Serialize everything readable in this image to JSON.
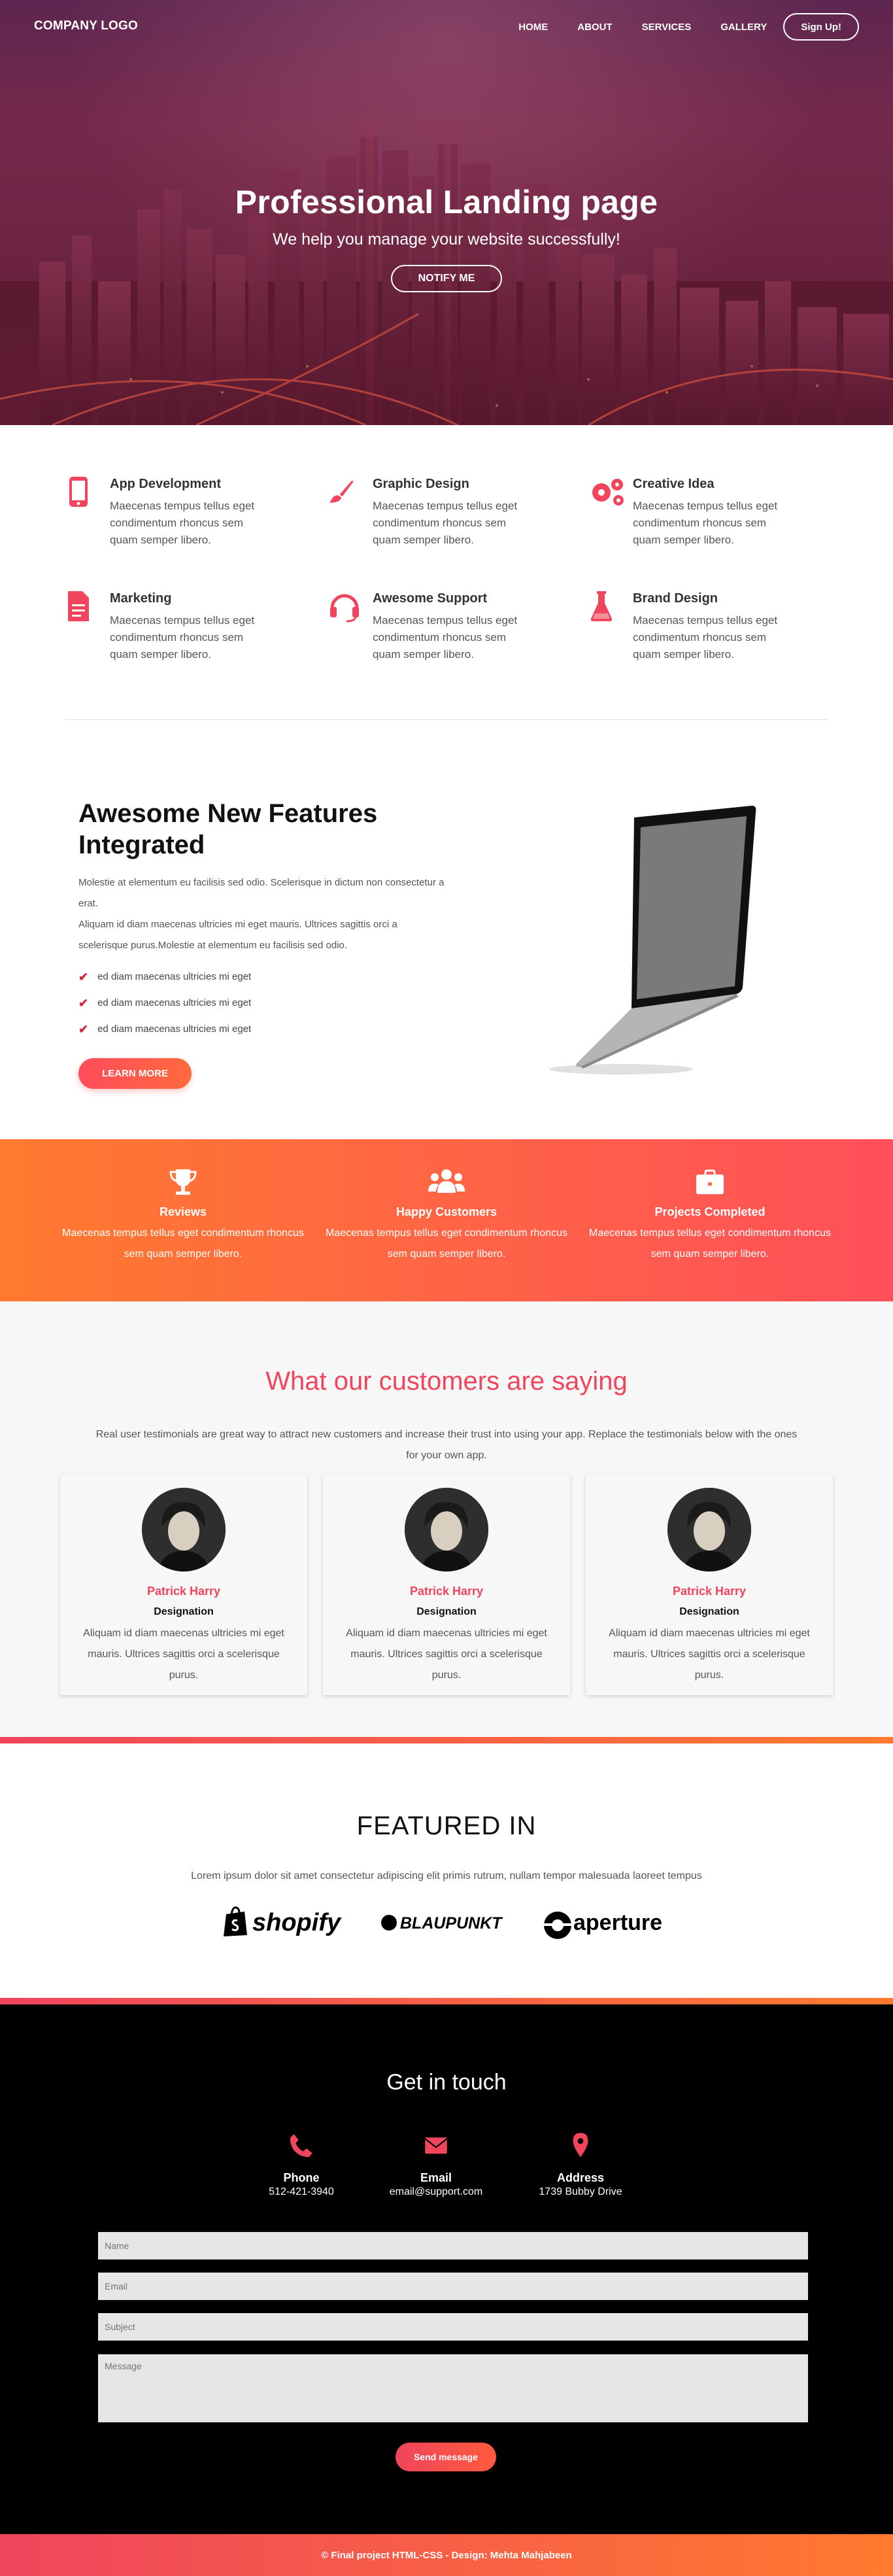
{
  "nav": {
    "logo": "COMPANY LOGO",
    "links": [
      "HOME",
      "ABOUT",
      "SERVICES",
      "GALLERY"
    ],
    "signup": "Sign Up!"
  },
  "hero": {
    "title": "Professional Landing page",
    "subtitle": "We help you manage your website successfully!",
    "button": "NOTIFY ME"
  },
  "services": [
    {
      "title": "App Development",
      "text": "Maecenas tempus tellus eget condimentum rhoncus sem quam semper libero.",
      "icon": "mobile-icon"
    },
    {
      "title": "Graphic Design",
      "text": "Maecenas tempus tellus eget condimentum rhoncus sem quam semper libero.",
      "icon": "paintbrush-icon"
    },
    {
      "title": "Creative Idea",
      "text": "Maecenas tempus tellus eget condimentum rhoncus sem quam semper libero.",
      "icon": "gears-icon"
    },
    {
      "title": "Marketing",
      "text": "Maecenas tempus tellus eget condimentum rhoncus sem quam semper libero.",
      "icon": "document-icon"
    },
    {
      "title": "Awesome Support",
      "text": "Maecenas tempus tellus eget condimentum rhoncus sem quam semper libero.",
      "icon": "headset-icon"
    },
    {
      "title": "Brand Design",
      "text": "Maecenas tempus tellus eget condimentum rhoncus sem quam semper libero.",
      "icon": "flask-icon"
    }
  ],
  "features": {
    "title": "Awesome New Features Integrated",
    "p1": "Molestie at elementum eu facilisis sed odio. Scelerisque in dictum non consectetur a erat.",
    "p2": "Aliquam id diam maecenas ultricies mi eget mauris. Ultrices sagittis orci a scelerisque purus.Molestie at elementum eu facilisis sed odio.",
    "checks": [
      "ed diam maecenas ultricies mi eget",
      "ed diam maecenas ultricies mi eget",
      "ed diam maecenas ultricies mi eget"
    ],
    "button": "LEARN MORE"
  },
  "stats": [
    {
      "title": "Reviews",
      "text": "Maecenas tempus tellus eget condimentum rhoncus sem quam semper libero.",
      "icon": "trophy-icon"
    },
    {
      "title": "Happy Customers",
      "text": "Maecenas tempus tellus eget condimentum rhoncus sem quam semper libero.",
      "icon": "users-icon"
    },
    {
      "title": "Projects Completed",
      "text": "Maecenas tempus tellus eget condimentum rhoncus sem quam semper libero.",
      "icon": "briefcase-icon"
    }
  ],
  "testimonials": {
    "title": "What our customers are saying",
    "intro": "Real user testimonials are great way to attract new customers and increase their trust into using your app. Replace the testimonials below with the ones for your own app.",
    "cards": [
      {
        "name": "Patrick Harry",
        "designation": "Designation",
        "text": "Aliquam id diam maecenas ultricies mi eget mauris. Ultrices sagittis orci a scelerisque purus."
      },
      {
        "name": "Patrick Harry",
        "designation": "Designation",
        "text": "Aliquam id diam maecenas ultricies mi eget mauris. Ultrices sagittis orci a scelerisque purus."
      },
      {
        "name": "Patrick Harry",
        "designation": "Designation",
        "text": "Aliquam id diam maecenas ultricies mi eget mauris. Ultrices sagittis orci a scelerisque purus."
      }
    ]
  },
  "featured": {
    "title": "FEATURED IN",
    "text": "Lorem ipsum dolor sit amet consectetur adipiscing elit primis rutrum, nullam tempor malesuada laoreet tempus",
    "brands": [
      "shopify",
      "BLAUPUNKT",
      "aperture"
    ]
  },
  "contact": {
    "title": "Get in touch",
    "items": [
      {
        "label": "Phone",
        "value": "512-421-3940",
        "icon": "phone-icon"
      },
      {
        "label": "Email",
        "value": "email@support.com",
        "icon": "envelope-icon"
      },
      {
        "label": "Address",
        "value": "1739 Bubby Drive",
        "icon": "map-marker-icon"
      }
    ],
    "placeholders": {
      "name": "Name",
      "email": "Email",
      "subject": "Subject",
      "message": "Message"
    },
    "button": "Send message"
  },
  "footer": "© Final project HTML-CSS - Design: Mehta Mahjabeen",
  "colors": {
    "accent": "#f0455d",
    "orange": "#ff7a2f",
    "dark": "#000000"
  }
}
